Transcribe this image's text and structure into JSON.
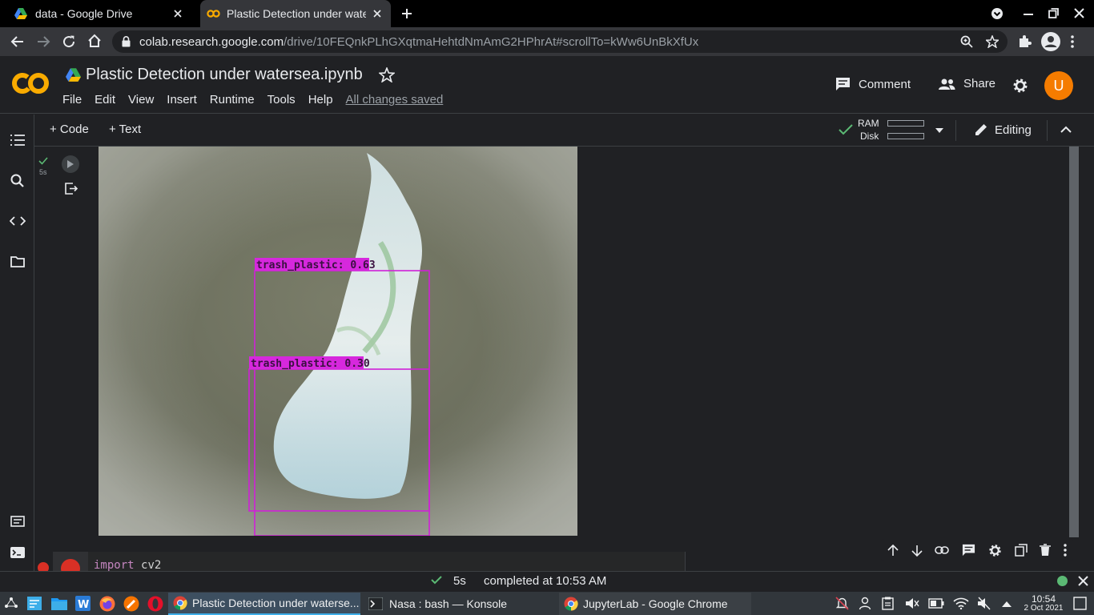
{
  "browser": {
    "tabs": [
      {
        "title": "data - Google Drive",
        "icon": "google-drive-icon"
      },
      {
        "title": "Plastic Detection under water",
        "icon": "colab-icon"
      }
    ],
    "url_host": "colab.research.google.com",
    "url_path": "/drive/10FEQnkPLhGXqtmaHehtdNmAmG2HPhrAt#scrollTo=kWw6UnBkXfUx"
  },
  "colab": {
    "logo_text": "CO",
    "notebook_title": "Plastic Detection under watersea.ipynb",
    "menu": [
      "File",
      "Edit",
      "View",
      "Insert",
      "Runtime",
      "Tools",
      "Help"
    ],
    "save_status": "All changes saved",
    "comment_label": "Comment",
    "share_label": "Share",
    "avatar_letter": "U",
    "add_code_label": "+ Code",
    "add_text_label": "+ Text",
    "ram_label": "RAM",
    "disk_label": "Disk",
    "editing_label": "Editing",
    "accent_color": "#f9ab00"
  },
  "cell": {
    "exec_time": "5s",
    "detections": [
      {
        "label": "trash_plastic: 0.63"
      },
      {
        "label": "trash_plastic: 0.30"
      }
    ],
    "next_code_keyword": "import",
    "next_code_text": "cv2"
  },
  "statusbar": {
    "duration": "5s",
    "message": "completed at 10:53 AM"
  },
  "taskbar": {
    "windows": [
      {
        "title": "Plastic Detection under waterse...",
        "icon": "chrome-icon"
      },
      {
        "title": "Nasa : bash — Konsole",
        "icon": "terminal-icon"
      },
      {
        "title": "JupyterLab - Google Chrome",
        "icon": "chrome-icon"
      }
    ],
    "time": "10:54",
    "date": "2 Oct 2021"
  }
}
